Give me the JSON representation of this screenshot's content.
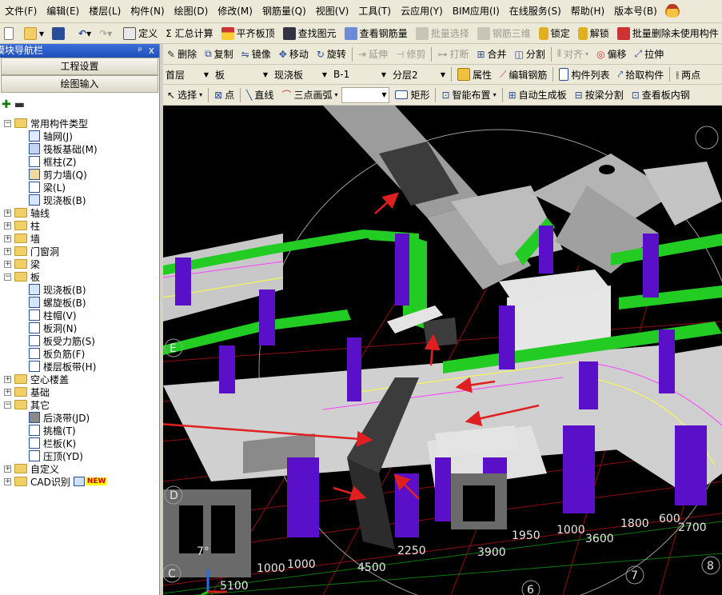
{
  "menu": [
    "文件(F)",
    "编辑(E)",
    "楼层(L)",
    "构件(N)",
    "绘图(D)",
    "修改(M)",
    "钢筋量(Q)",
    "视图(V)",
    "工具(T)",
    "云应用(Y)",
    "BIM应用(I)",
    "在线服务(S)",
    "帮助(H)",
    "版本号(B)"
  ],
  "toolbar1": {
    "define": "定义",
    "sum": "Σ 汇总计算",
    "align_slab": "平齐板顶",
    "find_element": "查找图元",
    "view_rebar": "查看钢筋量",
    "batch_select": "批量选择",
    "rebar_3d": "钢筋三维",
    "lock": "锁定",
    "unlock": "解锁",
    "batch_delete": "批量删除未使用构件"
  },
  "left_panel": {
    "title": "模块导航栏",
    "pin_glyph": "ᵖ",
    "close_glyph": "x",
    "btn_settings": "工程设置",
    "btn_draw": "绘图输入",
    "tree": [
      {
        "level": 0,
        "expander": "−",
        "type": "folder",
        "label": "常用构件类型"
      },
      {
        "level": 1,
        "icon": "grid",
        "label": "轴网(J)"
      },
      {
        "level": 1,
        "icon": "raft",
        "label": "筏板基础(M)"
      },
      {
        "level": 1,
        "icon": "column",
        "label": "框柱(Z)"
      },
      {
        "level": 1,
        "icon": "shearwall",
        "label": "剪力墙(Q)"
      },
      {
        "level": 1,
        "icon": "beam",
        "label": "梁(L)"
      },
      {
        "level": 1,
        "icon": "slab",
        "label": "现浇板(B)"
      },
      {
        "level": 0,
        "expander": "+",
        "type": "folder",
        "label": "轴线"
      },
      {
        "level": 0,
        "expander": "+",
        "type": "folder",
        "label": "柱"
      },
      {
        "level": 0,
        "expander": "+",
        "type": "folder",
        "label": "墙"
      },
      {
        "level": 0,
        "expander": "+",
        "type": "folder",
        "label": "门窗洞"
      },
      {
        "level": 0,
        "expander": "+",
        "type": "folder",
        "label": "梁"
      },
      {
        "level": 0,
        "expander": "−",
        "type": "folder",
        "label": "板"
      },
      {
        "level": 1,
        "icon": "slab",
        "label": "现浇板(B)"
      },
      {
        "level": 1,
        "icon": "spiral",
        "label": "螺旋板(B)"
      },
      {
        "level": 1,
        "icon": "capital",
        "label": "柱帽(V)"
      },
      {
        "level": 1,
        "icon": "hole",
        "label": "板洞(N)"
      },
      {
        "level": 1,
        "icon": "rebar",
        "label": "板受力筋(S)"
      },
      {
        "level": 1,
        "icon": "negrebar",
        "label": "板负筋(F)"
      },
      {
        "level": 1,
        "icon": "band",
        "label": "楼层板带(H)"
      },
      {
        "level": 0,
        "expander": "+",
        "type": "folder",
        "label": "空心楼盖"
      },
      {
        "level": 0,
        "expander": "+",
        "type": "folder",
        "label": "基础"
      },
      {
        "level": 0,
        "expander": "−",
        "type": "folder",
        "label": "其它"
      },
      {
        "level": 1,
        "icon": "postpour",
        "label": "后浇带(JD)"
      },
      {
        "level": 1,
        "icon": "cantilever",
        "label": "挑檐(T)"
      },
      {
        "level": 1,
        "icon": "parapet",
        "label": "栏板(K)"
      },
      {
        "level": 1,
        "icon": "coping",
        "label": "压顶(YD)"
      },
      {
        "level": 0,
        "expander": "+",
        "type": "folder",
        "label": "自定义"
      },
      {
        "level": 0,
        "expander": "+",
        "type": "folder",
        "label": "CAD识别",
        "badge": "NEW"
      }
    ]
  },
  "toolbar2": {
    "delete": "删除",
    "copy": "复制",
    "mirror": "镜像",
    "move": "移动",
    "rotate": "旋转",
    "extend": "延伸",
    "trim": "修剪",
    "break": "打断",
    "merge": "合并",
    "split": "分割",
    "align": "对齐",
    "offset": "偏移",
    "stretch": "拉伸"
  },
  "toolbar3": {
    "floor": "首层",
    "category": "板",
    "type": "现浇板",
    "name": "B-1",
    "layer": "分层2",
    "properties": "属性",
    "edit_rebar": "编辑钢筋",
    "element_list": "构件列表",
    "pick": "拾取构件",
    "two_points": "两点"
  },
  "toolbar4": {
    "select": "选择",
    "point": "点",
    "line": "直线",
    "arc": "三点画弧",
    "rect": "矩形",
    "smart_layout": "智能布置",
    "auto_slab": "自动生成板",
    "split_by_beam": "按梁分割",
    "view_slab": "查看板内钢"
  },
  "viewport": {
    "dimensions": [
      "1950",
      "1000",
      "3600",
      "1800",
      "600",
      "2700",
      "2250",
      "3900",
      "1000",
      "1000",
      "4500",
      "5100"
    ],
    "axis_labels": [
      "6",
      "7",
      "8",
      "E",
      "D",
      "C"
    ],
    "angle_label": "7°",
    "colors": {
      "background": "#000000",
      "slab": "#c8c8c8",
      "beam": "#22cc22",
      "column": "#5a10c8",
      "post_pour_strip": "#4a4a4a",
      "arrow": "#e02020",
      "grid": "#b01010"
    }
  }
}
